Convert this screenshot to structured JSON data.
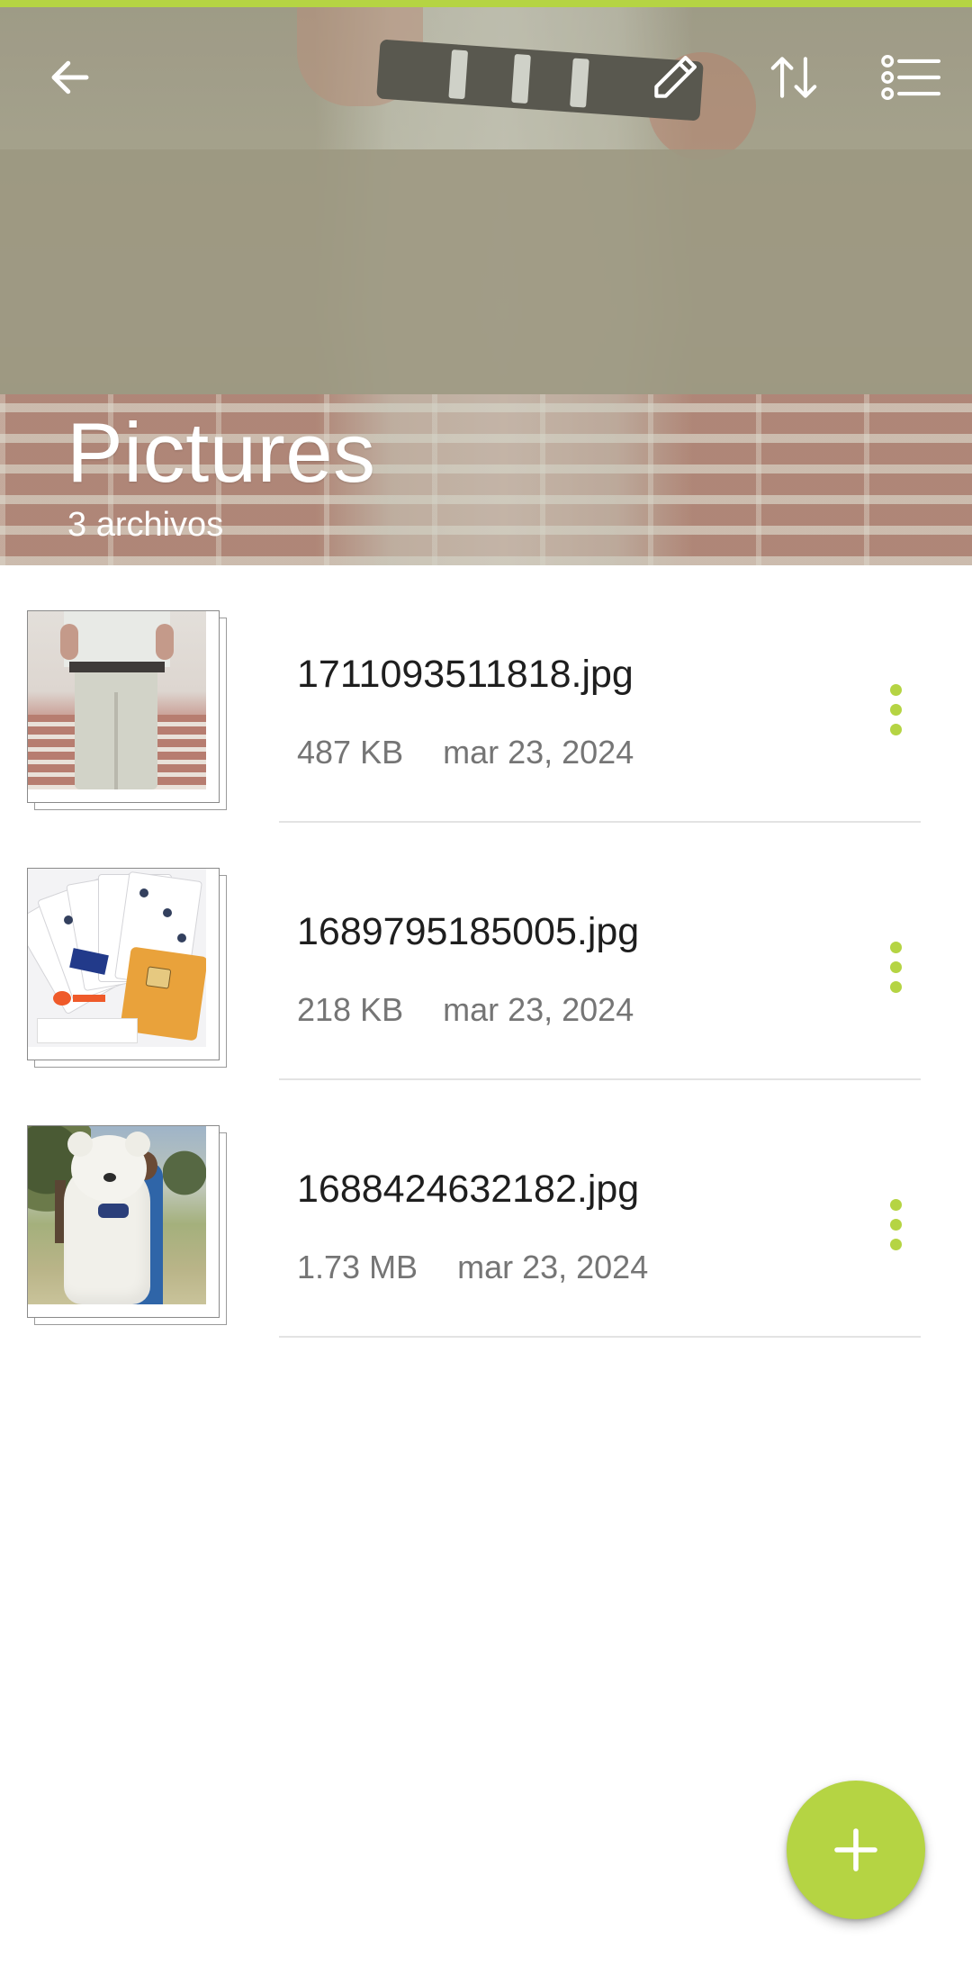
{
  "theme": {
    "accent": "#b5d443"
  },
  "header": {
    "title": "Pictures",
    "subtitle": "3 archivos",
    "actions": {
      "back": {
        "icon": "back-arrow-icon"
      },
      "edit": {
        "icon": "pencil-icon"
      },
      "sort": {
        "icon": "sort-arrows-icon"
      },
      "view": {
        "icon": "list-view-icon"
      }
    }
  },
  "files": [
    {
      "name": "1711093511818.jpg",
      "size": "487 KB",
      "date": "mar 23, 2024",
      "thumbnail": "photo-person-belt"
    },
    {
      "name": "1689795185005.jpg",
      "size": "218 KB",
      "date": "mar 23, 2024",
      "thumbnail": "photo-sim-cards"
    },
    {
      "name": "1688424632182.jpg",
      "size": "1.73 MB",
      "date": "mar 23, 2024",
      "thumbnail": "photo-teddy-bear"
    }
  ],
  "fab": {
    "icon": "plus-icon"
  }
}
